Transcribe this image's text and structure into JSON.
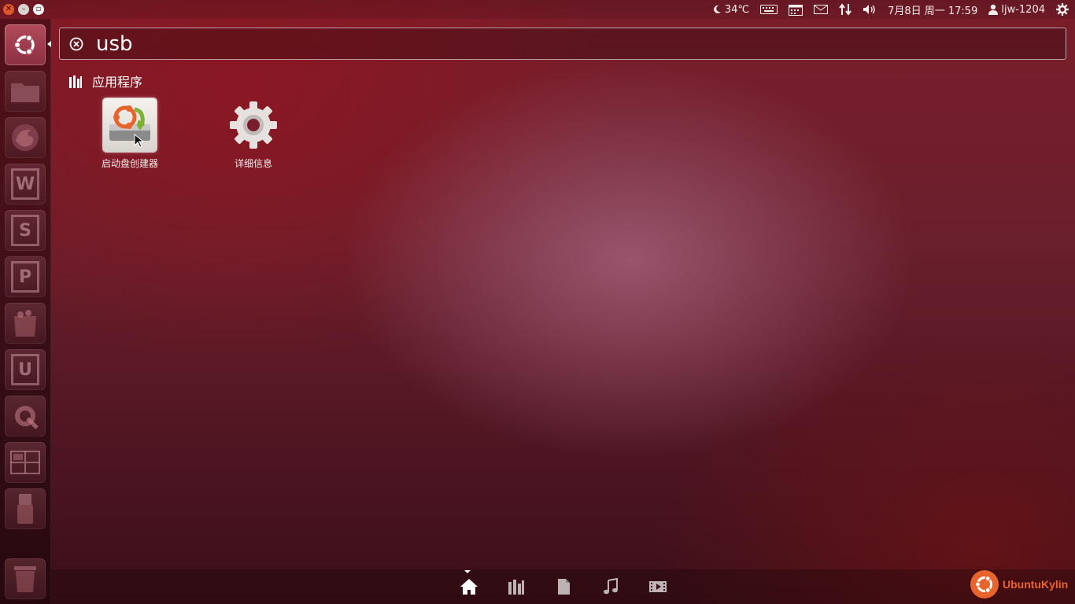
{
  "panel": {
    "weather": "34℃",
    "datetime": "7月8日 周一 17:59",
    "user": "ljw-1204"
  },
  "search": {
    "query": "usb"
  },
  "category": {
    "label": "应用程序"
  },
  "results": [
    {
      "label": "启动盘创建器",
      "icon": "startup-disk-creator-icon"
    },
    {
      "label": "详细信息",
      "icon": "details-gear-icon"
    }
  ],
  "launcher": {
    "items": [
      "dash-home",
      "files",
      "firefox",
      "wps-writer",
      "wps-spreadsheets",
      "wps-presentation",
      "software-center",
      "ubuntu-one",
      "system-settings",
      "workspace-switcher",
      "usb-drive",
      "trash"
    ]
  },
  "brand": {
    "name": "UbuntuKylin"
  },
  "colors": {
    "accent": "#e8642d",
    "close": "#e0572a"
  }
}
